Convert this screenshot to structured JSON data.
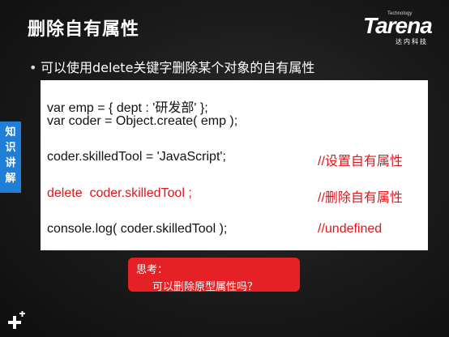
{
  "slide": {
    "title": "删除自有属性",
    "bullet": "可以使用delete关键字删除某个对象的自有属性",
    "side_tab": "知识讲解"
  },
  "logo": {
    "brand": "Tarena",
    "tagline": "Technology",
    "cn": "达内科技"
  },
  "code": {
    "line1": "var emp = { dept : '研发部' };",
    "line2": "var coder = Object.create( emp );",
    "line3": "coder.skilledTool = 'JavaScript';",
    "line3_comment": "//设置自有属性",
    "line4": "delete  coder.skilledTool ;",
    "line4_comment": "//删除自有属性",
    "line5": "console.log( coder.skilledTool );",
    "line5_comment": "//undefined"
  },
  "callout": {
    "line1": "思考：",
    "line2": "可以删除原型属性吗？"
  },
  "colors": {
    "accent_red": "#e0161b",
    "side_tab_blue": "#1f7fd6",
    "background": "#1a1a1a"
  }
}
